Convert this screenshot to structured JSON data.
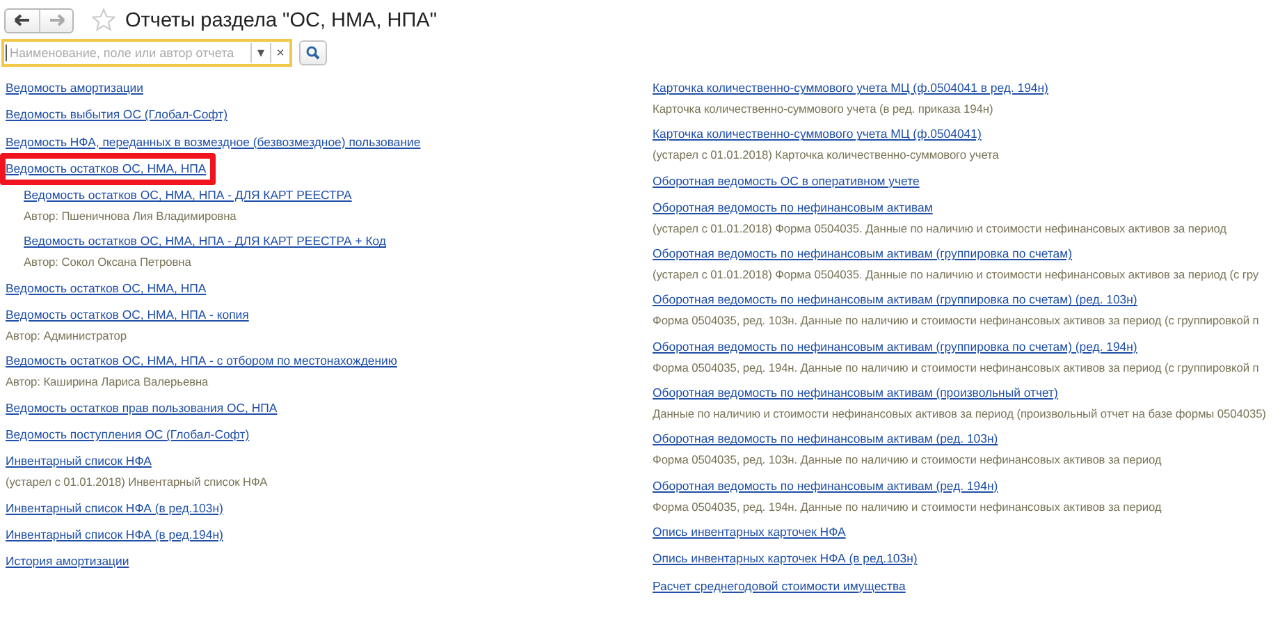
{
  "window": {
    "title": "Отчеты раздела \"ОС, НМА, НПА\"",
    "favorite": false
  },
  "search": {
    "placeholder": "Наименование, поле или автор отчета",
    "dropdown": "▾",
    "clear": "×"
  },
  "left_reports": [
    {
      "title": "Ведомость амортизации",
      "highlighted": false
    },
    {
      "title": "Ведомость выбытия ОС (Глобал-Софт)",
      "highlighted": false
    },
    {
      "title": "Ведомость НФА, переданных в возмездное (безвозмездное) пользование",
      "highlighted": false
    },
    {
      "title": "Ведомость остатков ОС, НМА, НПА",
      "highlighted": true,
      "children": [
        {
          "title": "Ведомость остатков ОС, НМА, НПА - ДЛЯ КАРТ РЕЕСТРА",
          "description": "Автор: Пшеничнова Лия Владимировна",
          "highlighted": false
        },
        {
          "title": "Ведомость остатков ОС, НМА, НПА - ДЛЯ КАРТ РЕЕСТРА + Код",
          "description": "Автор: Сокол Оксана Петровна",
          "highlighted": false
        }
      ]
    },
    {
      "title": "Ведомость остатков ОС, НМА, НПА",
      "highlighted": false
    },
    {
      "title": "Ведомость остатков ОС, НМА, НПА - копия",
      "description": "Автор: Администратор",
      "highlighted": false
    },
    {
      "title": "Ведомость остатков ОС, НМА, НПА - с отбором по местонахождению",
      "description": "Автор: Каширина Лариса Валерьевна",
      "highlighted": false
    },
    {
      "title": "Ведомость остатков прав пользования ОС, НПА",
      "highlighted": false
    },
    {
      "title": "Ведомость поступления ОС (Глобал-Софт)",
      "highlighted": false
    },
    {
      "title": "Инвентарный список НФА",
      "description": "(устарел с 01.01.2018) Инвентарный список НФА",
      "highlighted": false
    },
    {
      "title": "Инвентарный список НФА (в ред.103н)",
      "highlighted": false
    },
    {
      "title": "Инвентарный список НФА (в ред.194н)",
      "highlighted": false
    },
    {
      "title": "История амортизации",
      "highlighted": false
    }
  ],
  "right_reports": [
    {
      "title": "Карточка количественно-суммового учета МЦ  (ф.0504041 в ред. 194н)",
      "description": "Карточка количественно-суммового учета (в ред. приказа 194н)",
      "highlighted": false
    },
    {
      "title": "Карточка количественно-суммового учета МЦ  (ф.0504041)",
      "description": "(устарел с 01.01.2018) Карточка количественно-суммового учета",
      "highlighted": false
    },
    {
      "title": "Оборотная ведомость ОС в оперативном учете",
      "highlighted": false
    },
    {
      "title": "Оборотная ведомость по нефинансовым активам",
      "description": "(устарел с 01.01.2018) Форма 0504035. Данные по наличию и стоимости нефинансовых активов за период",
      "highlighted": false
    },
    {
      "title": "Оборотная ведомость по нефинансовым активам (группировка по счетам)",
      "description": "(устарел с 01.01.2018) Форма 0504035. Данные по наличию и стоимости нефинансовых активов за период (с гру",
      "highlighted": false
    },
    {
      "title": "Оборотная ведомость по нефинансовым активам (группировка по счетам) (ред. 103н)",
      "description": "Форма 0504035, ред. 103н. Данные по наличию и стоимости нефинансовых активов за период (с группировкой п",
      "highlighted": false
    },
    {
      "title": "Оборотная ведомость по нефинансовым активам (группировка по счетам) (ред. 194н)",
      "description": "Форма 0504035, ред. 194н. Данные по наличию и стоимости нефинансовых активов за период (с группировкой п",
      "highlighted": false
    },
    {
      "title": "Оборотная ведомость по нефинансовым активам (произвольный отчет)",
      "description": "Данные по наличию и стоимости нефинансовых активов за период (произвольный отчет на базе формы 0504035)",
      "highlighted": false
    },
    {
      "title": "Оборотная ведомость по нефинансовым активам (ред. 103н)",
      "description": "Форма 0504035, ред. 103н. Данные по наличию и стоимости нефинансовых активов за период",
      "highlighted": false
    },
    {
      "title": "Оборотная ведомость по нефинансовым активам (ред. 194н)",
      "description": "Форма 0504035, ред. 194н. Данные по наличию и стоимости нефинансовых активов за период",
      "highlighted": false
    },
    {
      "title": "Опись инвентарных карточек НФА",
      "highlighted": false
    },
    {
      "title": "Опись инвентарных карточек НФА (в ред.103н)",
      "highlighted": false
    },
    {
      "title": "Расчет среднегодовой стоимости имущества",
      "highlighted": false
    }
  ]
}
